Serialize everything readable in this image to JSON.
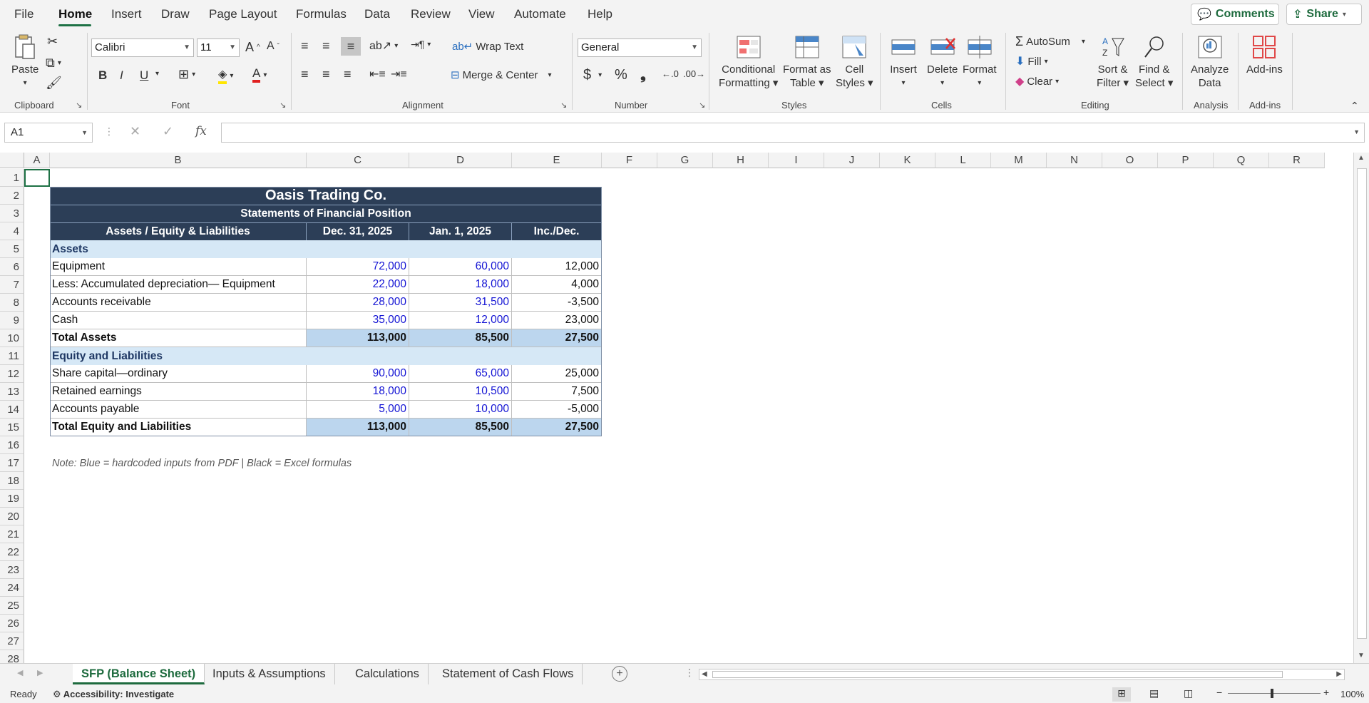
{
  "menu": {
    "items": [
      "File",
      "Home",
      "Insert",
      "Draw",
      "Page Layout",
      "Formulas",
      "Data",
      "Review",
      "View",
      "Automate",
      "Help"
    ],
    "comments": "Comments",
    "share": "Share"
  },
  "ribbon": {
    "clipboard": {
      "paste": "Paste",
      "label": "Clipboard"
    },
    "font": {
      "name": "Calibri",
      "size": "11",
      "bold": "B",
      "italic": "I",
      "underline": "U",
      "label": "Font"
    },
    "alignment": {
      "wrap": "Wrap Text",
      "merge": "Merge & Center",
      "label": "Alignment"
    },
    "number": {
      "format": "General",
      "currency": "$",
      "percent": "%",
      "comma": "❟",
      "label": "Number"
    },
    "styles": {
      "conditional": [
        "Conditional",
        "Formatting"
      ],
      "format_table": [
        "Format as",
        "Table"
      ],
      "cell_styles": [
        "Cell",
        "Styles"
      ],
      "label": "Styles"
    },
    "cells": {
      "insert": "Insert",
      "delete": "Delete",
      "format": "Format",
      "label": "Cells"
    },
    "editing": {
      "autosum": "AutoSum",
      "fill": "Fill",
      "clear": "Clear",
      "sort": [
        "Sort &",
        "Filter"
      ],
      "find": [
        "Find &",
        "Select"
      ],
      "label": "Editing"
    },
    "analysis": {
      "analyze": [
        "Analyze",
        "Data"
      ],
      "label": "Analysis"
    },
    "addins": {
      "addins": "Add-ins",
      "label": "Add-ins"
    }
  },
  "formula_bar": {
    "name_box": "A1",
    "fx": "fx",
    "content": ""
  },
  "columns": [
    "A",
    "B",
    "C",
    "D",
    "E",
    "F",
    "G",
    "H",
    "I",
    "J",
    "K",
    "L",
    "M",
    "N",
    "O",
    "P",
    "Q",
    "R"
  ],
  "rows": [
    "1",
    "2",
    "3",
    "4",
    "5",
    "6",
    "7",
    "8",
    "9",
    "10",
    "11",
    "12",
    "13",
    "14",
    "15",
    "16",
    "17",
    "18",
    "19",
    "20",
    "21",
    "22",
    "23",
    "24",
    "25",
    "26",
    "27",
    "28"
  ],
  "sheet": {
    "title": "Oasis Trading Co.",
    "subtitle": "Statements of Financial Position",
    "headers": [
      "Assets / Equity & Liabilities",
      "Dec. 31, 2025",
      "Jan. 1, 2025",
      "Inc./Dec."
    ],
    "assets_label": "Assets",
    "assets": [
      [
        "Equipment",
        "72,000",
        "60,000",
        "12,000"
      ],
      [
        "Less: Accumulated depreciation— Equipment",
        "22,000",
        "18,000",
        "4,000"
      ],
      [
        "Accounts receivable",
        "28,000",
        "31,500",
        "-3,500"
      ],
      [
        "Cash",
        "35,000",
        "12,000",
        "23,000"
      ]
    ],
    "total_assets": [
      "Total Assets",
      "113,000",
      "85,500",
      "27,500"
    ],
    "equity_label": "Equity and Liabilities",
    "equity": [
      [
        "Share capital—ordinary",
        "90,000",
        "65,000",
        "25,000"
      ],
      [
        "Retained earnings",
        "18,000",
        "10,500",
        "7,500"
      ],
      [
        "Accounts payable",
        "5,000",
        "10,000",
        "-5,000"
      ]
    ],
    "total_equity": [
      "Total Equity and Liabilities",
      "113,000",
      "85,500",
      "27,500"
    ],
    "note": "Note: Blue = hardcoded inputs from PDF  |  Black = Excel formulas"
  },
  "tabs": [
    "SFP (Balance Sheet)",
    "Inputs & Assumptions",
    "Calculations",
    "Statement of Cash Flows"
  ],
  "status": {
    "ready": "Ready",
    "accessibility": "Accessibility: Investigate",
    "zoom": "100%"
  },
  "colors": {
    "header": "#2c3e57",
    "section": "#d6e8f6",
    "total": "#bcd6ee",
    "input": "#1414d4",
    "accent": "#1e7145"
  }
}
